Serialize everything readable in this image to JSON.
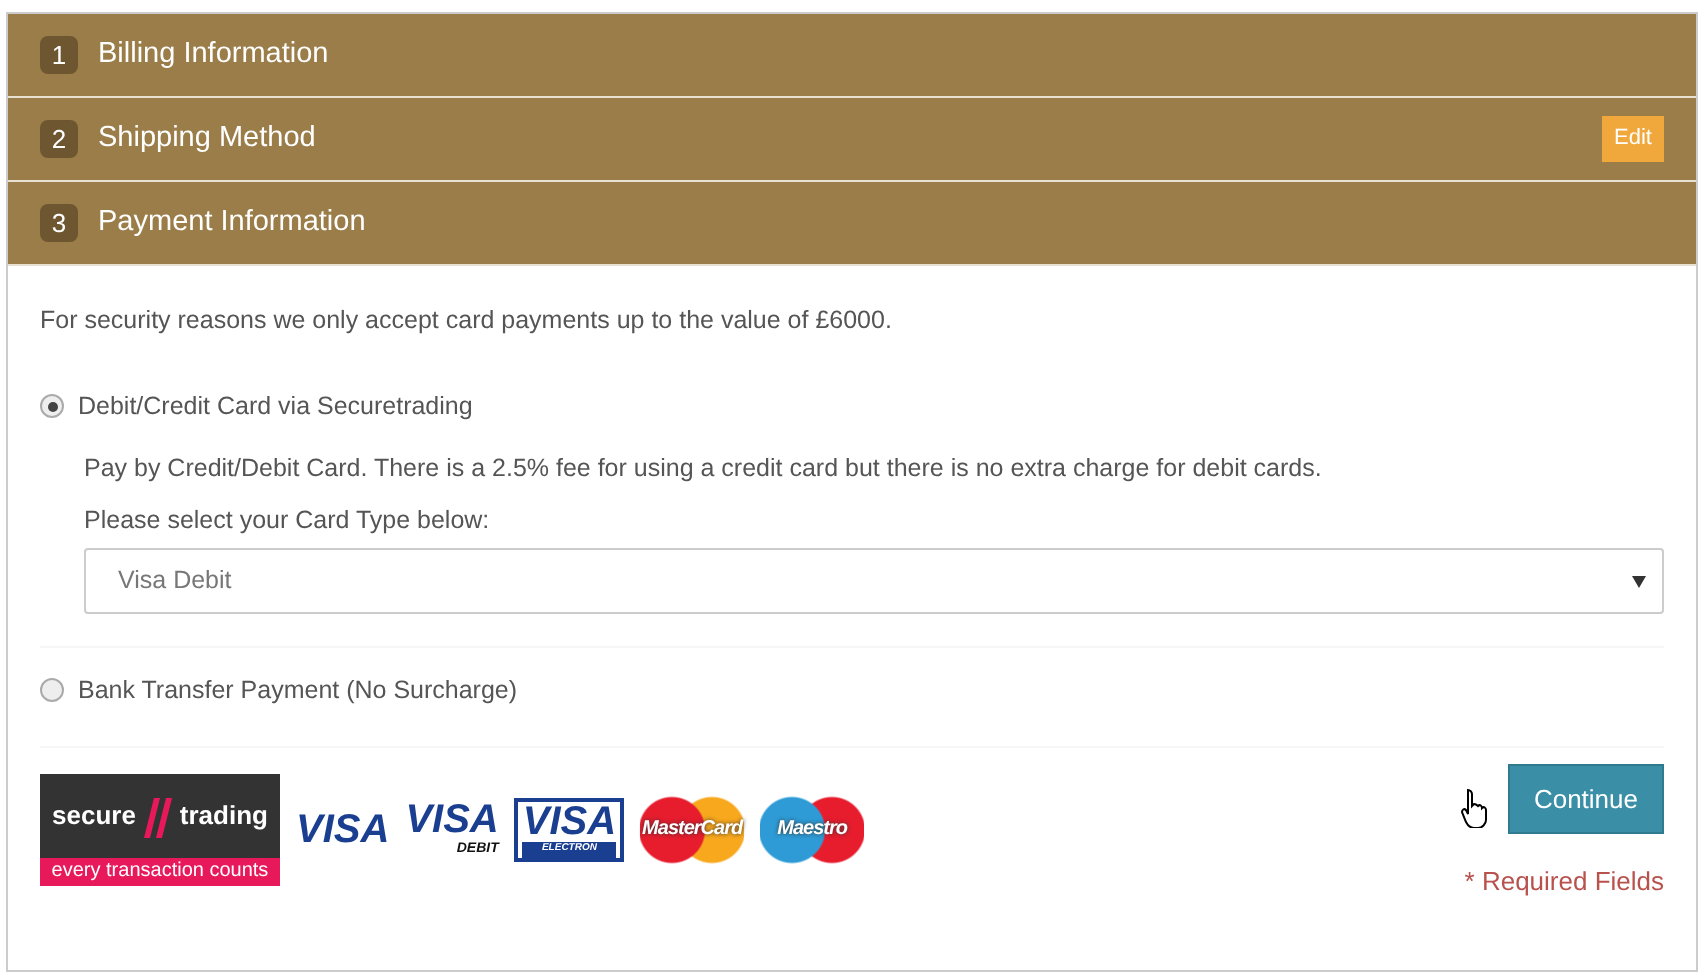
{
  "steps": [
    {
      "number": "1",
      "title": "Billing Information"
    },
    {
      "number": "2",
      "title": "Shipping Method",
      "edit": "Edit"
    },
    {
      "number": "3",
      "title": "Payment Information"
    }
  ],
  "payment": {
    "notice": "For security reasons we only accept card payments up to the value of £6000.",
    "options": [
      {
        "label": "Debit/Credit Card via Securetrading",
        "selected": true,
        "description": "Pay by Credit/Debit Card. There is a 2.5% fee for using a credit card but there is no extra charge for debit cards.",
        "select_label": "Please select your Card Type below:",
        "select_value": "Visa Debit"
      },
      {
        "label": "Bank Transfer Payment (No Surcharge)",
        "selected": false
      }
    ],
    "provider_logo": {
      "left": "secure",
      "right": "trading",
      "tagline": "every transaction counts"
    },
    "card_logos": [
      {
        "kind": "visa",
        "text": "VISA"
      },
      {
        "kind": "visa_debit",
        "text": "VISA",
        "subtext": "DEBIT"
      },
      {
        "kind": "visa_electron",
        "text": "VISA",
        "subtext": "ELECTRON"
      },
      {
        "kind": "mastercard",
        "text": "MasterCard"
      },
      {
        "kind": "maestro",
        "text": "Maestro"
      }
    ],
    "continue_button": "Continue",
    "required_note": "* Required Fields"
  }
}
